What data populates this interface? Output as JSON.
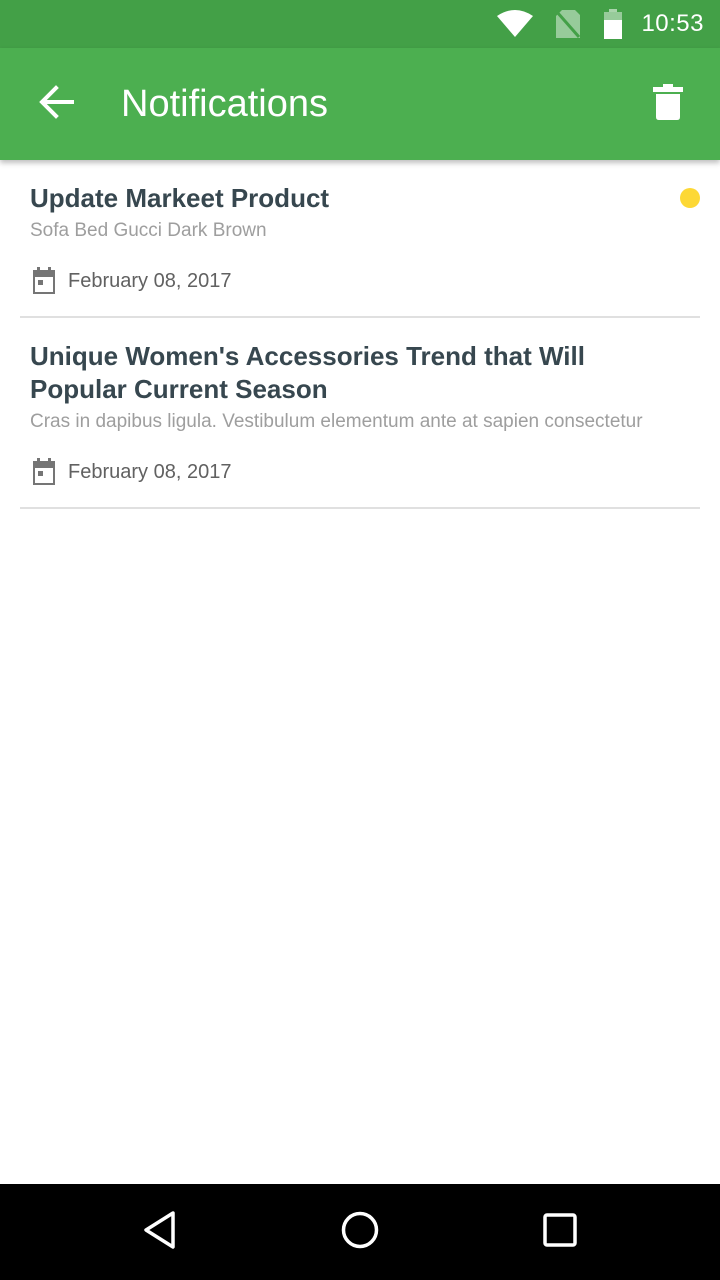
{
  "status_bar": {
    "time": "10:53",
    "icons": [
      "wifi-icon",
      "no-sim-icon",
      "battery-icon"
    ]
  },
  "app_bar": {
    "title": "Notifications",
    "back_icon": "arrow-left-icon",
    "action_icon": "trash-icon"
  },
  "notifications": [
    {
      "title": "Update Markeet Product",
      "description": "Sofa Bed Gucci Dark Brown",
      "date": "February 08, 2017",
      "unread": true
    },
    {
      "title": "Unique Women's Accessories Trend that Will Popular Current Season",
      "description": "Cras in dapibus ligula. Vestibulum elementum ante at sapien consectetur",
      "date": "February 08, 2017",
      "unread": false
    }
  ],
  "colors": {
    "status_bar": "#43a047",
    "app_bar": "#4caf50",
    "unread_dot": "#fdd835",
    "title_text": "#37474f"
  },
  "nav_bar": {
    "buttons": [
      "back-triangle-icon",
      "home-circle-icon",
      "recent-square-icon"
    ]
  }
}
